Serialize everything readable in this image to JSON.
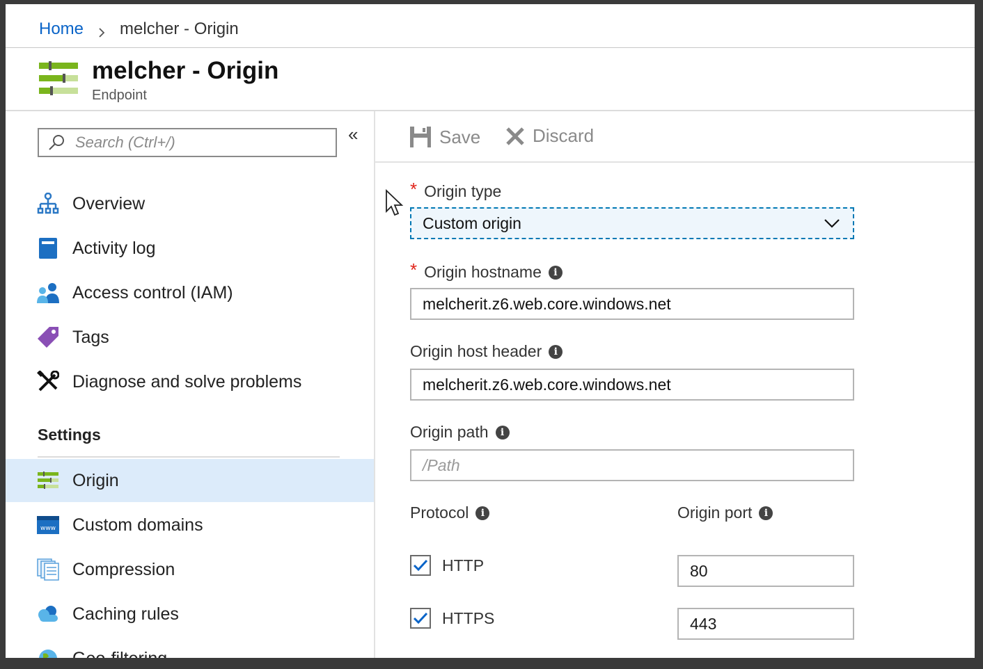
{
  "breadcrumb": {
    "home": "Home",
    "current": "melcher - Origin"
  },
  "header": {
    "title": "melcher - Origin",
    "subtitle": "Endpoint",
    "icon": "origin-sliders-icon"
  },
  "sidebar": {
    "search_placeholder": "Search (Ctrl+/)",
    "collapse_icon": "«",
    "items": [
      {
        "label": "Overview",
        "icon": "overview-hierarchy-icon"
      },
      {
        "label": "Activity log",
        "icon": "activity-log-book-icon"
      },
      {
        "label": "Access control (IAM)",
        "icon": "access-control-users-icon"
      },
      {
        "label": "Tags",
        "icon": "tag-icon"
      },
      {
        "label": "Diagnose and solve problems",
        "icon": "wrench-tools-icon"
      }
    ],
    "settings_label": "Settings",
    "settings_items": [
      {
        "label": "Origin",
        "icon": "origin-sliders-icon",
        "active": true
      },
      {
        "label": "Custom domains",
        "icon": "www-icon"
      },
      {
        "label": "Compression",
        "icon": "compression-files-icon"
      },
      {
        "label": "Caching rules",
        "icon": "cloud-icon"
      },
      {
        "label": "Geo-filtering",
        "icon": "globe-icon"
      }
    ]
  },
  "toolbar": {
    "save_label": "Save",
    "discard_label": "Discard"
  },
  "form": {
    "origin_type": {
      "label": "Origin type",
      "value": "Custom origin",
      "required": true
    },
    "origin_hostname": {
      "label": "Origin hostname",
      "value": "melcherit.z6.web.core.windows.net",
      "required": true
    },
    "origin_host_header": {
      "label": "Origin host header",
      "value": "melcherit.z6.web.core.windows.net"
    },
    "origin_path": {
      "label": "Origin path",
      "placeholder": "/Path"
    },
    "protocol": {
      "label": "Protocol",
      "http_label": "HTTP",
      "https_label": "HTTPS",
      "http_checked": true,
      "https_checked": true
    },
    "origin_port": {
      "label": "Origin port",
      "http_port": "80",
      "https_port": "443"
    }
  },
  "required_marker": "*",
  "info_marker": "i",
  "colors": {
    "accent": "#0a64c8",
    "required": "#e0251b",
    "active_bg": "#dcebfa",
    "icon_green": "#7ab51d"
  }
}
